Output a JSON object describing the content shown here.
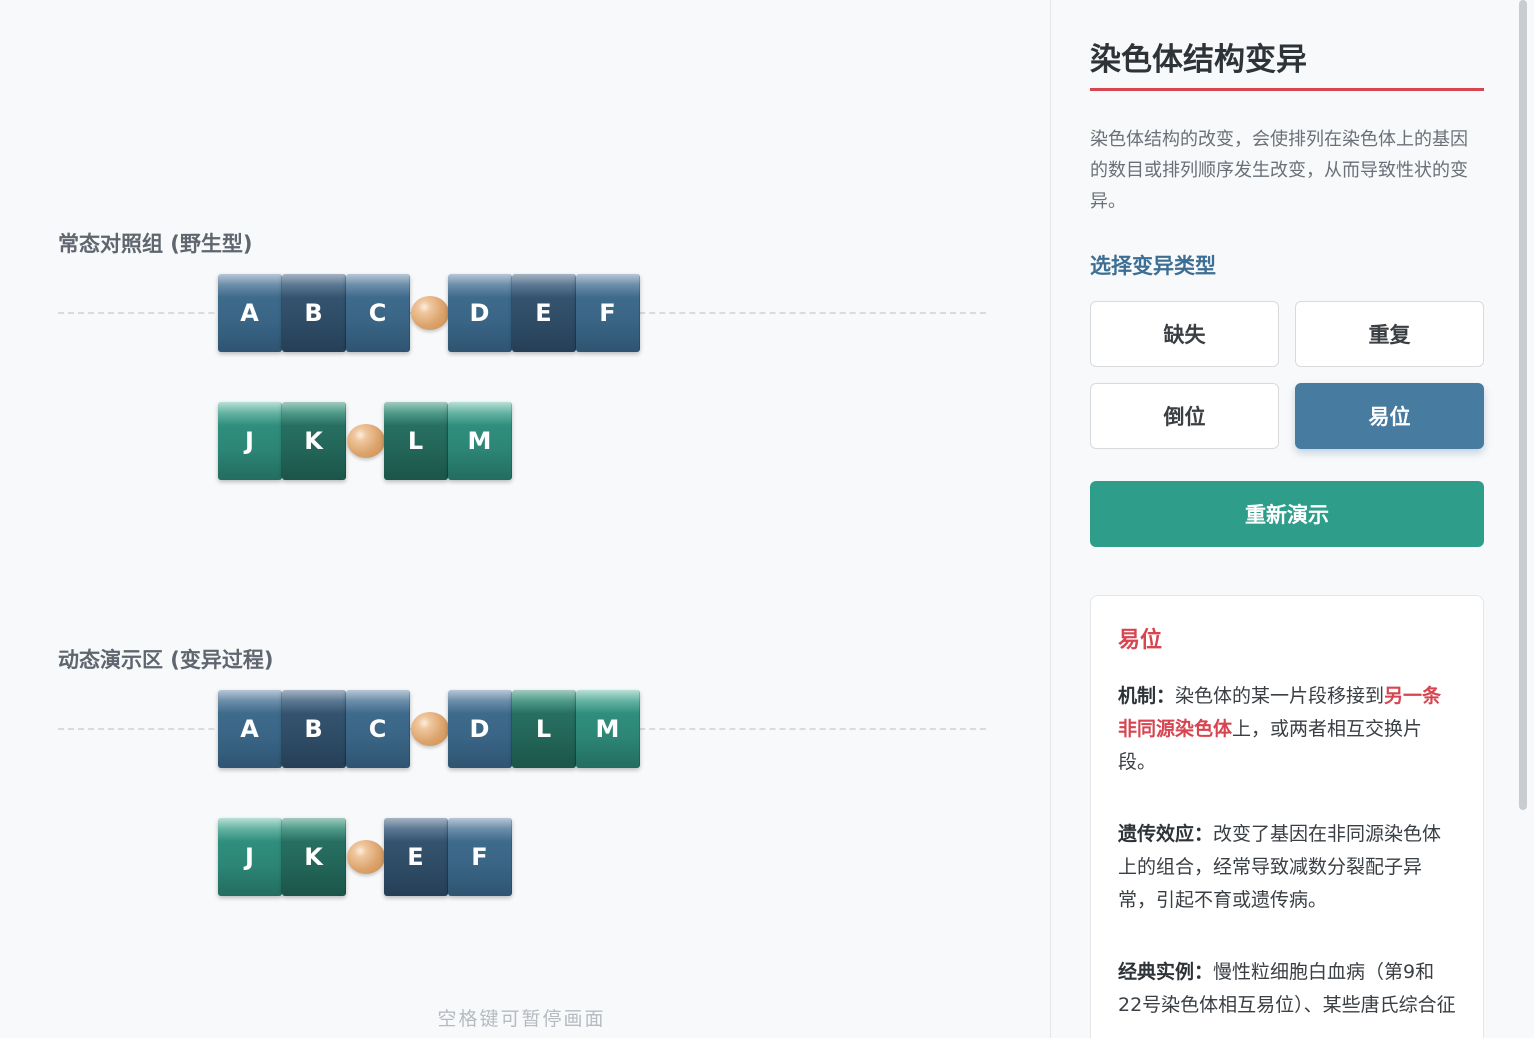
{
  "stage": {
    "control": {
      "title": "常态对照组 (野生型)",
      "chromosomes": [
        {
          "genes": [
            {
              "label": "A",
              "color": "blue"
            },
            {
              "label": "B",
              "color": "blue-alt"
            },
            {
              "label": "C",
              "color": "blue"
            },
            {
              "label": "D",
              "color": "blue"
            },
            {
              "label": "E",
              "color": "blue-alt"
            },
            {
              "label": "F",
              "color": "blue"
            }
          ]
        },
        {
          "genes": [
            {
              "label": "J",
              "color": "green"
            },
            {
              "label": "K",
              "color": "green-alt"
            },
            {
              "label": "L",
              "color": "green-alt"
            },
            {
              "label": "M",
              "color": "green"
            }
          ]
        }
      ]
    },
    "demo": {
      "title": "动态演示区 (变异过程)",
      "chromosomes": [
        {
          "genes": [
            {
              "label": "A",
              "color": "blue"
            },
            {
              "label": "B",
              "color": "blue-alt"
            },
            {
              "label": "C",
              "color": "blue"
            },
            {
              "label": "D",
              "color": "blue"
            },
            {
              "label": "L",
              "color": "green-alt"
            },
            {
              "label": "M",
              "color": "green"
            }
          ]
        },
        {
          "genes": [
            {
              "label": "J",
              "color": "green"
            },
            {
              "label": "K",
              "color": "green-alt"
            },
            {
              "label": "E",
              "color": "blue-alt"
            },
            {
              "label": "F",
              "color": "blue"
            }
          ]
        }
      ]
    },
    "hint": "空格键可暂停画面"
  },
  "panel": {
    "title": "染色体结构变异",
    "intro": "染色体结构的改变，会使排列在染色体上的基因的数目或排列顺序发生改变，从而导致性状的变异。",
    "subhead": "选择变异类型",
    "types": [
      "缺失",
      "重复",
      "倒位",
      "易位"
    ],
    "active_type": "易位",
    "replay_label": "重新演示",
    "info": {
      "title": "易位",
      "mechanism_label": "机制：",
      "mechanism_pre": "染色体的某一片段移接到",
      "mechanism_hl": "另一条非同源染色体",
      "mechanism_post": "上，或两者相互交换片段。",
      "effect_label": "遗传效应：",
      "effect_text": "改变了基因在非同源染色体上的组合，经常导致减数分裂配子异常，引起不育或遗传病。",
      "example_label": "经典实例：",
      "example_text": "慢性粒细胞白血病（第9和22号染色体相互易位）、某些唐氏综合征"
    }
  },
  "colors": {
    "accent_red": "#d64550",
    "active_blue": "#477ba0",
    "replay_green": "#2e9e8a",
    "gene_blue": "#3a6585",
    "gene_green": "#2c8676",
    "centromere": "#dca46d"
  }
}
